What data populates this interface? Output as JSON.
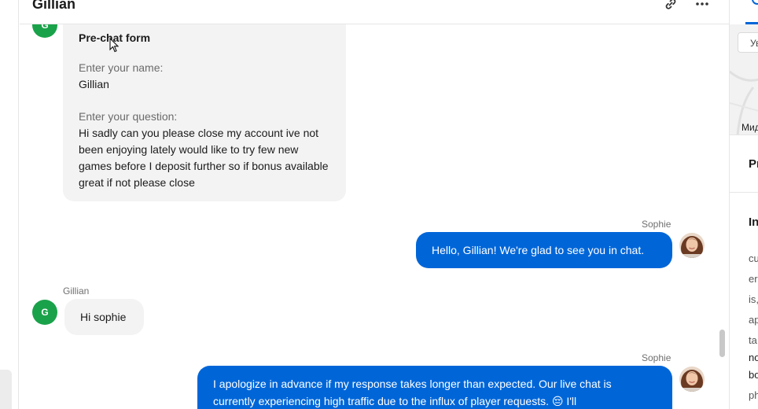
{
  "header": {
    "contact_name": "Gillian"
  },
  "prechat_form": {
    "title": "Pre-chat form",
    "name_label": "Enter your name:",
    "name_value": "Gillian",
    "question_label": "Enter your question:",
    "question_value": "Hi sadly can you please close my account ive not been enjoying lately would like to try few new games before I deposit further so if bonus available great if not please close"
  },
  "customer_avatar_initial": "G",
  "messages": [
    {
      "sender": "Sophie",
      "text": "Hello, Gillian! We're glad to see you in chat."
    },
    {
      "sender": "Gillian",
      "text": "Hi sophie"
    },
    {
      "sender": "Sophie",
      "text": "I apologize in advance if my response takes longer than expected. Our live chat is currently experiencing high traffic due to the influx of player requests. 😔 I'll"
    }
  ],
  "right_panel": {
    "map_chip": "Ув",
    "map_label": "Мид",
    "section1_heading": "Pr",
    "section2_heading": "In",
    "text_fragments": [
      "cu",
      "er",
      "is,",
      "ap",
      "ta",
      "no",
      "bo",
      "ph"
    ]
  },
  "colors": {
    "agent_bubble": "#0066d8",
    "customer_bubble": "#f3f3f3",
    "customer_avatar": "#1aa24a"
  }
}
